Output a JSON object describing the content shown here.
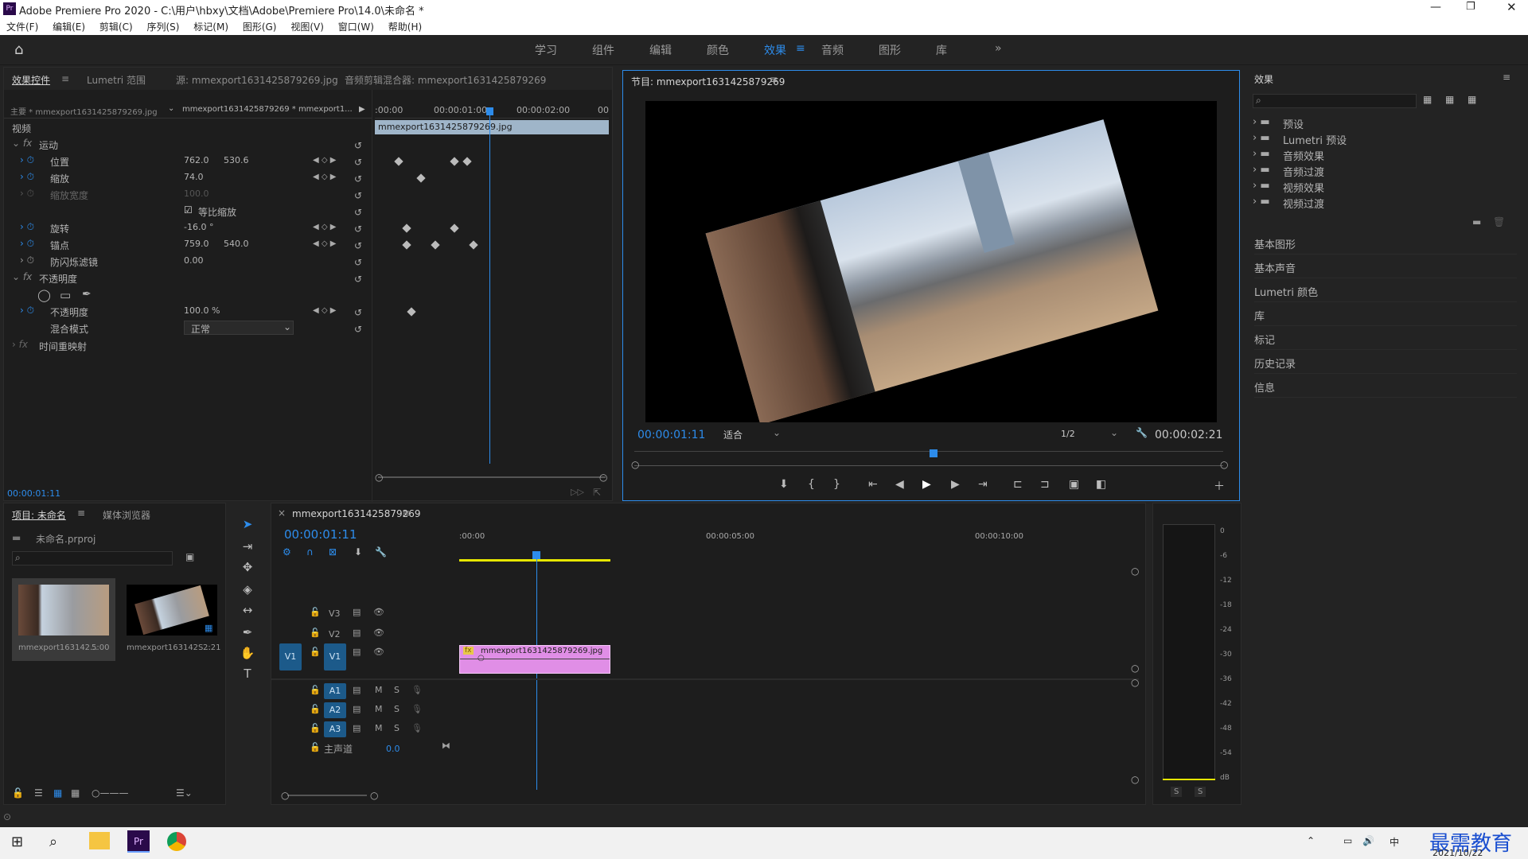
{
  "titlebar": {
    "app_title": "Adobe Premiere Pro 2020 - C:\\用户\\hbxy\\文档\\Adobe\\Premiere Pro\\14.0\\未命名 *"
  },
  "menu": [
    "文件(F)",
    "编辑(E)",
    "剪辑(C)",
    "序列(S)",
    "标记(M)",
    "图形(G)",
    "视图(V)",
    "窗口(W)",
    "帮助(H)"
  ],
  "workspaces": [
    "学习",
    "组件",
    "编辑",
    "颜色",
    "效果",
    "音频",
    "图形",
    "库"
  ],
  "colors": {
    "accent": "#2d8ceb",
    "clip": "#e08ee6",
    "work_area": "#e6e600"
  },
  "effect_controls": {
    "tabs": [
      "效果控件",
      "Lumetri 范围",
      "源: mmexport1631425879269.jpg",
      "音频剪辑混合器: mmexport1631425879269"
    ],
    "master": "主要 * mmexport1631425879269.jpg",
    "sequence_clip": "mmexport1631425879269 * mmexport1...",
    "timecodes": [
      ":00:00",
      "00:00:01:00",
      "00:00:02:00",
      "00"
    ],
    "clip_bar": "mmexport1631425879269.jpg",
    "video_header": "视频",
    "motion": "运动",
    "position": {
      "label": "位置",
      "x": "762.0",
      "y": "530.6"
    },
    "scale": {
      "label": "缩放",
      "value": "74.0"
    },
    "scale_width": {
      "label": "缩放宽度",
      "value": "100.0"
    },
    "uniform_scale": "等比缩放",
    "rotation": {
      "label": "旋转",
      "value": "-16.0 °"
    },
    "anchor": {
      "label": "锚点",
      "x": "759.0",
      "y": "540.0"
    },
    "anti_flicker": {
      "label": "防闪烁滤镜",
      "value": "0.00"
    },
    "opacity_group": "不透明度",
    "opacity": {
      "label": "不透明度",
      "value": "100.0 %"
    },
    "blend_mode": {
      "label": "混合模式",
      "value": "正常"
    },
    "time_remap": "时间重映射",
    "current_time": "00:00:01:11"
  },
  "program_monitor": {
    "title": "节目: mmexport1631425879269",
    "timecode": "00:00:01:11",
    "fit": "适合",
    "resolution": "1/2",
    "duration": "00:00:02:21"
  },
  "effects_panel": {
    "title": "效果",
    "folders": [
      "预设",
      "Lumetri 预设",
      "音频效果",
      "音频过渡",
      "视频效果",
      "视频过渡"
    ],
    "sections": [
      "基本图形",
      "基本声音",
      "Lumetri 颜色",
      "库",
      "标记",
      "历史记录",
      "信息"
    ]
  },
  "project_panel": {
    "tabs": [
      "项目: 未命名",
      "媒体浏览器"
    ],
    "project_file": "未命名.prproj",
    "items": [
      {
        "name": "mmexport163142...",
        "duration": "5:00"
      },
      {
        "name": "mmexport163142S...",
        "duration": "2:21"
      }
    ]
  },
  "timeline": {
    "sequence": "mmexport1631425879269",
    "timecode": "00:00:01:11",
    "ruler": [
      ":00:00",
      "00:00:05:00",
      "00:00:10:00"
    ],
    "video_tracks": [
      "V3",
      "V2",
      "V1"
    ],
    "audio_tracks": [
      "A1",
      "A2",
      "A3"
    ],
    "source_patch": "V1",
    "master": {
      "label": "主声道",
      "value": "0.0"
    },
    "clip_label": "mmexport1631425879269.jpg",
    "playhead_time": "00:00:01:11"
  },
  "audio_meter": {
    "scale": [
      "0",
      "-6",
      "-12",
      "-18",
      "-24",
      "-30",
      "-36",
      "-42",
      "-48",
      "-54",
      "dB"
    ],
    "solo": [
      "S",
      "S"
    ]
  },
  "taskbar": {
    "date": "2021/10/22",
    "watermark": "最需教育",
    "ime": "中"
  }
}
